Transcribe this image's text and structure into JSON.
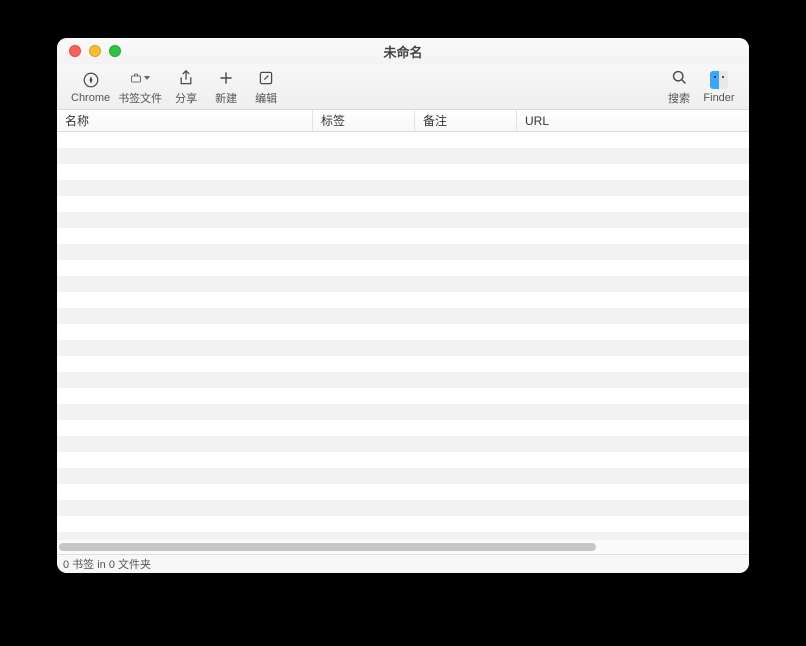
{
  "window": {
    "title": "未命名"
  },
  "toolbar": {
    "chrome": "Chrome",
    "bookmarks": "书签文件",
    "share": "分享",
    "new": "新建",
    "edit": "编辑",
    "search": "搜索",
    "finder": "Finder"
  },
  "columns": {
    "name": "名称",
    "tag": "标签",
    "note": "备注",
    "url": "URL"
  },
  "status": "0 书签 in 0 文件夹",
  "rows_count": 26
}
